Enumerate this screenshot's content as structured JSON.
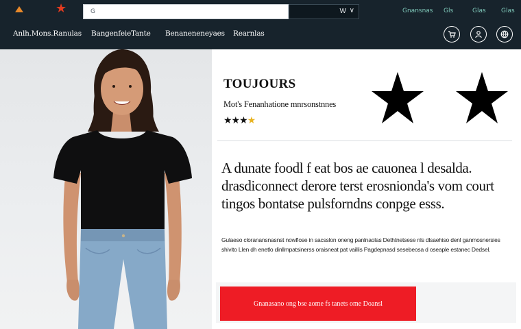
{
  "header": {
    "search": {
      "placeholder": "G"
    },
    "search_dropdown": {
      "label": "W"
    },
    "top_links": [
      "Gnansnas",
      "Gls",
      "Glas",
      "Glas"
    ],
    "nav": [
      "Anlh.Mons.Ranulas",
      "Bangenfeie",
      "Tante",
      "Benaneneneyaes",
      "Rearnlas"
    ],
    "icons": [
      "cart-icon",
      "user-icon",
      "globe-icon"
    ]
  },
  "product": {
    "brand": "TOUJOURS",
    "subtitle": "Mot's Fenanhatione mnrsonstnnes",
    "rating": 3.5,
    "rating_display": "★★★",
    "headline": "A dunate foodl f eat bos ae cauonea l desalda. drasdiconnect derore terst erosnionda's vom court tingos bontatse pulsforndns conpge esss.",
    "body": "Gulaeso cloranansnasnst nowflose in sacsslon oneng panlnaolas Dethtnetsese nls dlsaehiso denl ganmosnersies shivito Llen dh enetlo dinllmpatsinerss oraisneat pat vaillis Pagdepnasd sesebeosa d oseaple estanec Dedsel.",
    "cta_label": "Gnanasano ong bse aome fs tanets ome Doansl"
  },
  "colors": {
    "header_bg": "#17232c",
    "accent_link": "#7fc8b9",
    "cta": "#ee1c25",
    "star_half": "#e8b320"
  }
}
